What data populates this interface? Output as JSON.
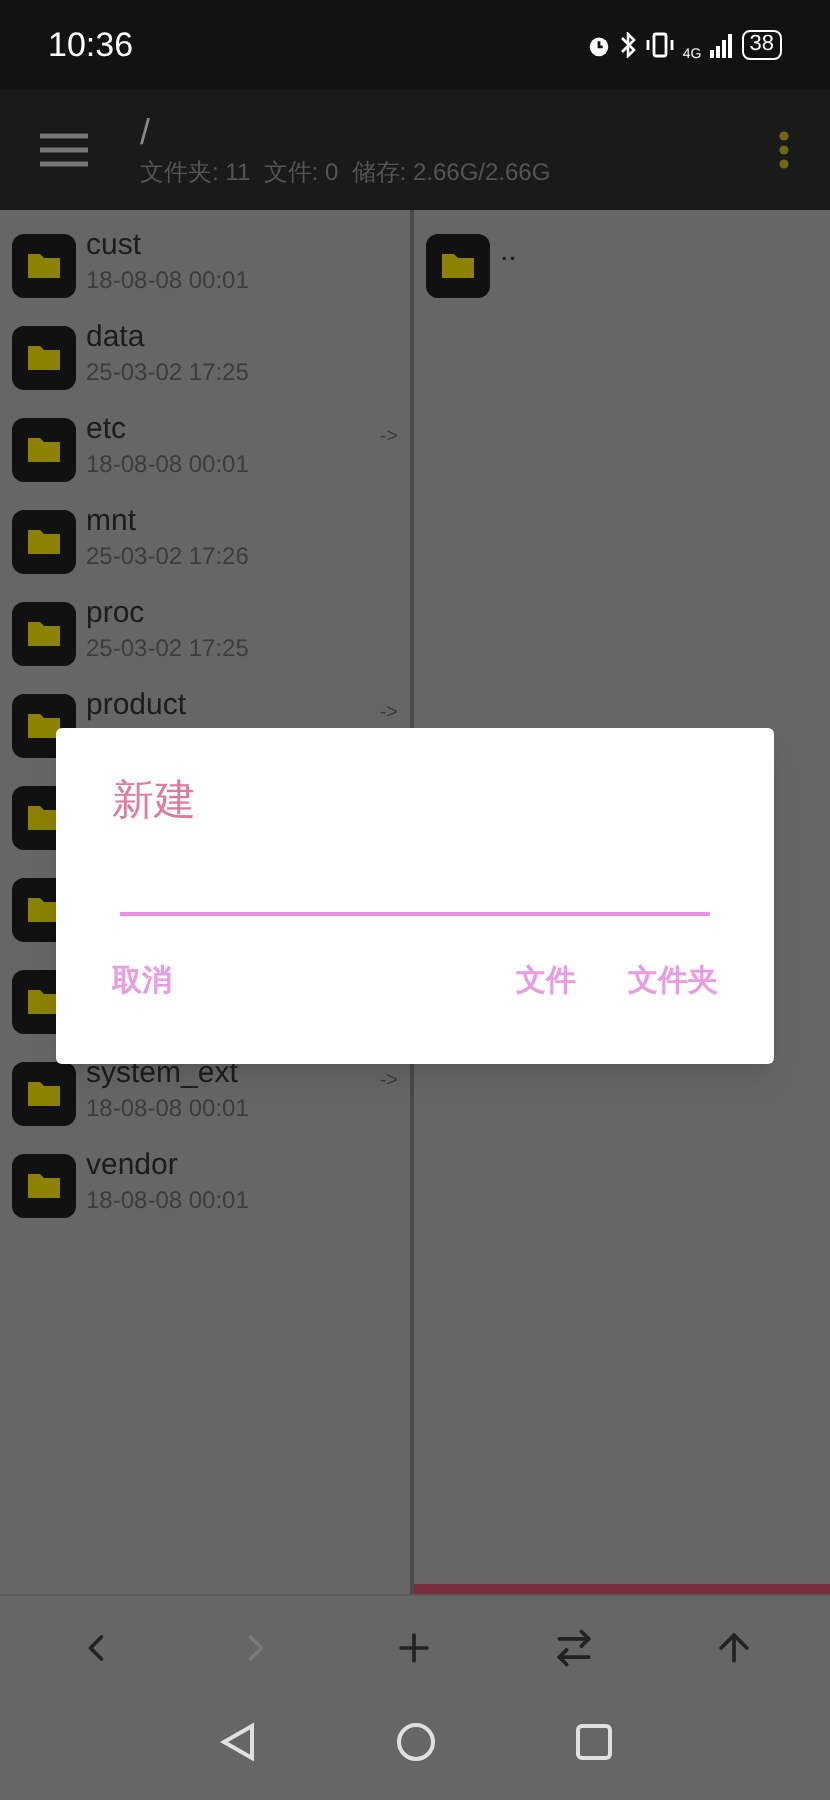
{
  "status_bar": {
    "time": "10:36",
    "network": "4G",
    "battery": "38"
  },
  "toolbar": {
    "title": "/",
    "subtitle": "文件夹: 11  文件: 0  储存: 2.66G/2.66G"
  },
  "left_pane": {
    "items": [
      {
        "kind": "entry",
        "name": "cust",
        "date": "18-08-08 00:01"
      },
      {
        "kind": "entry",
        "name": "data",
        "date": "25-03-02 17:25"
      },
      {
        "kind": "entry",
        "name": "etc",
        "date": "18-08-08 00:01",
        "arrow": "->"
      },
      {
        "kind": "entry",
        "name": "mnt",
        "date": "25-03-02 17:26"
      },
      {
        "kind": "entry",
        "name": "proc",
        "date": "25-03-02 17:25"
      },
      {
        "kind": "entry",
        "name": "product",
        "arrow": "->"
      },
      {
        "kind": "covered"
      },
      {
        "kind": "covered"
      },
      {
        "kind": "covered"
      },
      {
        "kind": "entry",
        "name": "system_ext",
        "date": "18-08-08 00:01",
        "arrow": "->"
      },
      {
        "kind": "entry",
        "name": "vendor",
        "date": "18-08-08 00:01"
      }
    ]
  },
  "right_pane": {
    "active": true,
    "items": [
      {
        "name": ".."
      }
    ]
  },
  "dialog": {
    "title": "新建",
    "buttons": [
      {
        "label": "取消"
      },
      {
        "label": "文件"
      },
      {
        "label": "文件夹"
      }
    ]
  },
  "bottom_bar": {
    "buttons": [
      {
        "kind": "back",
        "disabled": false
      },
      {
        "kind": "forward",
        "disabled": true
      },
      {
        "kind": "add",
        "disabled": false
      },
      {
        "kind": "swap",
        "disabled": false
      },
      {
        "kind": "up",
        "disabled": false
      }
    ]
  }
}
